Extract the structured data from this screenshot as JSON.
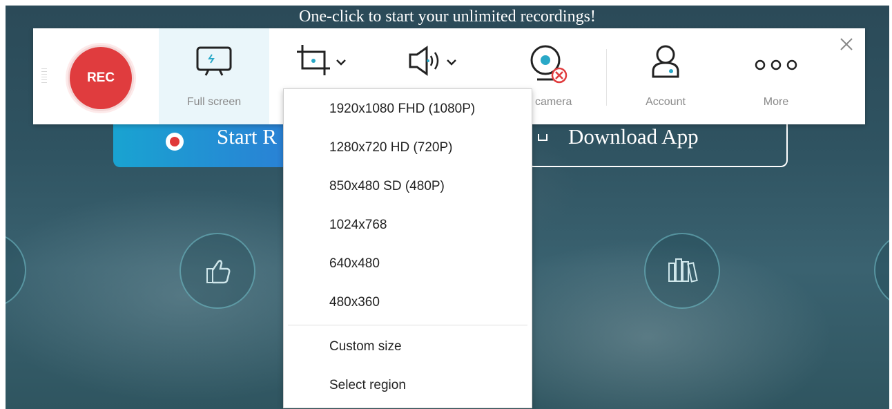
{
  "banner": {
    "headline": "One-click to start your unlimited recordings!"
  },
  "hero": {
    "start_label": "Start R",
    "download_label": "Download App"
  },
  "toolbar": {
    "rec_label": "REC",
    "fullscreen_label": "Full screen",
    "webcam_label": "b camera",
    "account_label": "Account",
    "more_label": "More"
  },
  "resolution_menu": {
    "items": [
      "1920x1080 FHD (1080P)",
      "1280x720 HD (720P)",
      "850x480 SD (480P)",
      "1024x768",
      "640x480",
      "480x360"
    ],
    "custom_size": "Custom size",
    "select_region": "Select region"
  },
  "colors": {
    "rec_red": "#e03c3e",
    "accent_teal": "#29a8c7",
    "icon_dark": "#222222"
  }
}
